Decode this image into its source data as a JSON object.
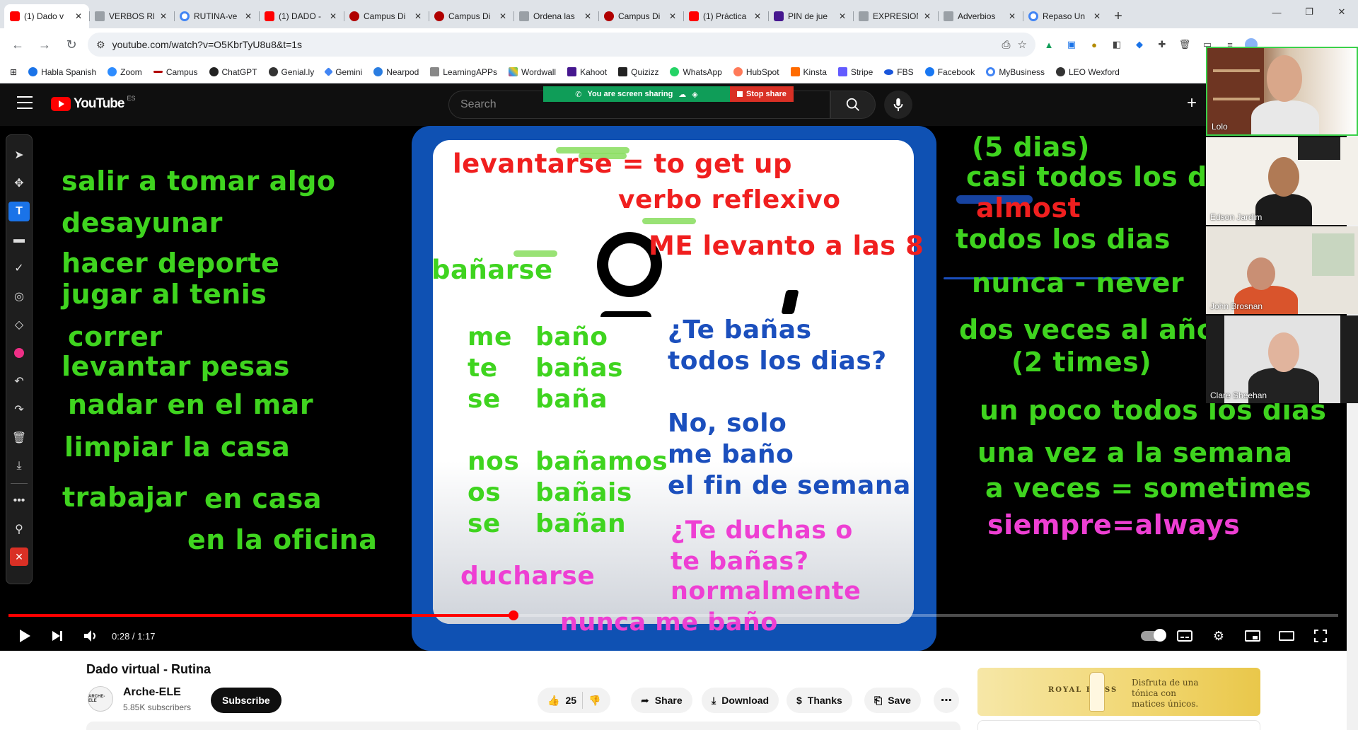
{
  "browser": {
    "tabs": [
      {
        "label": "(1) Dado v",
        "icon": "youtube-icon",
        "active": true
      },
      {
        "label": "VERBOS RE",
        "icon": "doc-icon"
      },
      {
        "label": "RUTINA-ve",
        "icon": "google-icon"
      },
      {
        "label": "(1) DADO -",
        "icon": "youtube-icon"
      },
      {
        "label": "Campus Di",
        "icon": "campus-icon"
      },
      {
        "label": "Campus Di",
        "icon": "campus-icon"
      },
      {
        "label": "Ordena las",
        "icon": "doc-icon"
      },
      {
        "label": "Campus Di",
        "icon": "campus-icon"
      },
      {
        "label": "(1) Práctica",
        "icon": "youtube-icon"
      },
      {
        "label": "PIN de jue",
        "icon": "kahoot-icon"
      },
      {
        "label": "EXPRESION",
        "icon": "doc-icon"
      },
      {
        "label": "Adverbios",
        "icon": "doc-icon"
      },
      {
        "label": "Repaso Un",
        "icon": "google-icon"
      }
    ],
    "url": "youtube.com/watch?v=O5KbrTyU8u8&t=1s",
    "bookmarks": [
      {
        "label": "Habla Spanish",
        "color": "#1a73e8"
      },
      {
        "label": "Zoom",
        "color": "#2d8cff"
      },
      {
        "label": "Campus",
        "color": "#b00000"
      },
      {
        "label": "ChatGPT",
        "color": "#222222"
      },
      {
        "label": "Genial.ly",
        "color": "#333333"
      },
      {
        "label": "Gemini",
        "color": "#4285f4"
      },
      {
        "label": "Nearpod",
        "color": "#2a7de1"
      },
      {
        "label": "LearningAPPs",
        "color": "#888888"
      },
      {
        "label": "Wordwall",
        "color": "#e43f5a"
      },
      {
        "label": "Kahoot",
        "color": "#46178f"
      },
      {
        "label": "Quizizz",
        "color": "#222222"
      },
      {
        "label": "WhatsApp",
        "color": "#25d366"
      },
      {
        "label": "HubSpot",
        "color": "#ff7a59"
      },
      {
        "label": "Kinsta",
        "color": "#ff6b00"
      },
      {
        "label": "Stripe",
        "color": "#635bff"
      },
      {
        "label": "FBS",
        "color": "#1a56db"
      },
      {
        "label": "Facebook",
        "color": "#1877f2"
      },
      {
        "label": "MyBusiness",
        "color": "#4285f4"
      },
      {
        "label": "LEO Wexford",
        "color": "#333333"
      }
    ]
  },
  "youtube": {
    "logo": "YouTube",
    "country": "ES",
    "search_placeholder": "Search"
  },
  "screen_share": {
    "message": "You are screen sharing",
    "stop_label": "Stop share"
  },
  "video": {
    "left_words": [
      "salir a tomar algo",
      "desayunar",
      "hacer deporte",
      "jugar al tenis",
      "correr",
      "levantar pesas",
      "nadar en el mar",
      "limpiar la casa",
      "trabajar",
      "en casa",
      "en la oficina"
    ],
    "board": {
      "title": "levantarse = to get up",
      "subtitle": "verbo reflexivo",
      "example": "ME levanto a las 8",
      "verb": "bañarse",
      "pronouns": [
        "me",
        "te",
        "se",
        "nos",
        "os",
        "se"
      ],
      "forms": [
        "baño",
        "bañas",
        "baña",
        "bañamos",
        "bañais",
        "bañan"
      ],
      "question1_line1": "¿Te bañas",
      "question1_line2": "todos los dias?",
      "answer_line1": "No, solo",
      "answer_line2": "me baño",
      "answer_line3": "el fin de semana",
      "question2_line1": "¿Te duchas o",
      "question2_line2": "te bañas?",
      "question2_line3": "normalmente",
      "verb2": "ducharse",
      "bottom": "nunca me baño"
    },
    "right_words": {
      "five_days": "(5 dias)",
      "almost_every": "casi todos los dia",
      "almost": "almost",
      "every_day": "todos los dias",
      "never": "nunca - never",
      "twice_year": "dos veces al año",
      "two_times": "(2 times)",
      "a_little": "un poco todos los dias",
      "once_week": "una vez a la semana",
      "sometimes": "a veces = sometimes",
      "always": "siempre=always"
    },
    "time": "0:28 / 1:17",
    "progress": 0.38
  },
  "participants": [
    {
      "name": "Lolo"
    },
    {
      "name": "Edson Jardim"
    },
    {
      "name": "John Brosnan"
    },
    {
      "name": "Clare Sheehan"
    }
  ],
  "below": {
    "title": "Dado virtual - Rutina",
    "channel": "Arche-ELE",
    "avatar_text": "ARCHE-ELE",
    "subscribers": "5.85K subscribers",
    "subscribe_label": "Subscribe",
    "likes": "25",
    "share_label": "Share",
    "download_label": "Download",
    "thanks_label": "Thanks",
    "save_label": "Save",
    "ad_brand": "ROYAL BLISS",
    "ad_tagline": "Disfruta de una tónica con matices únicos."
  }
}
